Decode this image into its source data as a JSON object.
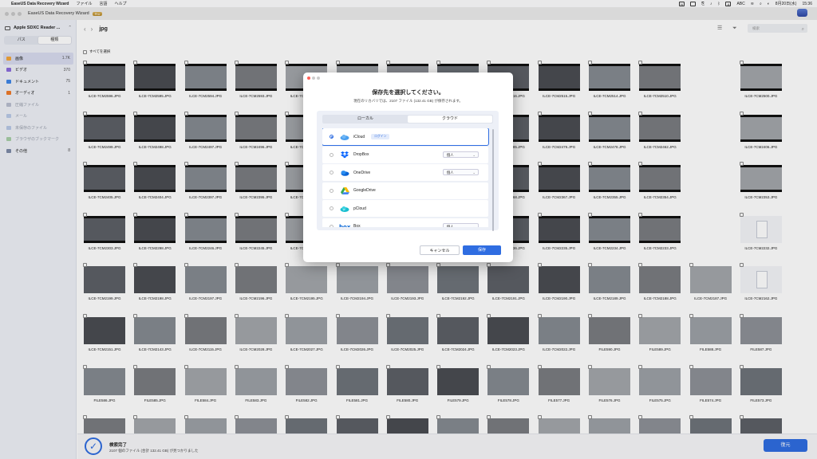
{
  "menubar": {
    "app": "EaseUS Data Recovery Wizard",
    "items": [
      "ファイル",
      "言語",
      "ヘルプ"
    ],
    "date": "8月20日(水)",
    "time": "15:36",
    "input": "ABC"
  },
  "window": {
    "title": "EaseUS Data Recovery Wizard",
    "badge": "Pro"
  },
  "sidebar": {
    "drive": "Apple SDXC Reader ...",
    "segments": [
      "パス",
      "種類"
    ],
    "active_segment": 1,
    "categories": [
      {
        "label": "画像",
        "count": "1.7K",
        "color": "#f2a53a",
        "active": true,
        "dim": false
      },
      {
        "label": "ビデオ",
        "count": "370",
        "color": "#8b6cdd",
        "active": false,
        "dim": false
      },
      {
        "label": "ドキュメント",
        "count": "75",
        "color": "#3f86e8",
        "active": false,
        "dim": false
      },
      {
        "label": "オーディオ",
        "count": "1",
        "color": "#ef7b2b",
        "active": false,
        "dim": false
      },
      {
        "label": "圧縮ファイル",
        "count": "",
        "color": "#b9bed0",
        "active": false,
        "dim": true
      },
      {
        "label": "メール",
        "count": "",
        "color": "#b9c9e8",
        "active": false,
        "dim": true
      },
      {
        "label": "未保存のファイル",
        "count": "",
        "color": "#b8c8e6",
        "active": false,
        "dim": true
      },
      {
        "label": "ブラウザのブックマーク",
        "count": "",
        "color": "#a8cfa8",
        "active": false,
        "dim": true
      },
      {
        "label": "その他",
        "count": "8",
        "color": "#7d8aa8",
        "active": false,
        "dim": false
      }
    ]
  },
  "toolbar": {
    "folder": "jpg",
    "search_placeholder": "検索",
    "select_all": "すべてを選択"
  },
  "files": [
    "ILCE-7CM2596.JPG",
    "ILCE-7CM2595.JPG",
    "ILCE-7CM2594.JPG",
    "ILCE-7CM2593.JPG",
    "ILCE-7CM2592.JPG",
    "ILCE-7CM2591.JPG",
    "ILCE-7CM2590.JPG",
    "ILCE-7CM2589.JPG",
    "ILCE-7CM2516.JPG",
    "ILCE-7CM2515.JPG",
    "ILCE-7CM2514.JPG",
    "ILCE-7CM2510.JPG",
    "ILCE-7CM2500.JPG",
    "ILCE-7CM2499.JPG",
    "ILCE-7CM2498.JPG",
    "ILCE-7CM2497.JPG",
    "ILCE-7CM2496.JPG",
    "ILCE-7CM2495.JPG",
    "ILCE-7CM2494.JPG",
    "ILCE-7CM2493.JPG",
    "ILCE-7CM2491.JPG",
    "ILCE-7CM2485.JPG",
    "ILCE-7CM2479.JPG",
    "ILCE-7CM2478.JPG",
    "ILCE-7CM2462.JPG",
    "ILCE-7CM2406.JPG",
    "ILCE-7CM2405.JPG",
    "ILCE-7CM2404.JPG",
    "ILCE-7CM2397.JPG",
    "ILCE-7CM2395.JPG",
    "ILCE-7CM2394.JPG",
    "ILCE-7CM2392.JPG",
    "ILCE-7CM2391.JPG",
    "ILCE-7CM2389.JPG",
    "ILCE-7CM2368.JPG",
    "ILCE-7CM2367.JPG",
    "ILCE-7CM2355.JPG",
    "ILCE-7CM2354.JPG",
    "ILCE-7CM2353.JPG",
    "ILCE-7CM2303.JPG",
    "ILCE-7CM2298.JPG",
    "ILCE-7CM2246.JPG",
    "ILCE-7CM2245.JPG",
    "ILCE-7CM2244.JPG",
    "ILCE-7CM2242.JPG",
    "ILCE-7CM2241.JPG",
    "ILCE-7CM2240.JPG",
    "ILCE-7CM2236.JPG",
    "ILCE-7CM2235.JPG",
    "ILCE-7CM2234.JPG",
    "ILCE-7CM2233.JPG",
    "ILCE-7CM2232.JPG",
    "ILCE-7CM2199.JPG",
    "ILCE-7CM2198.JPG",
    "ILCE-7CM2197.JPG",
    "ILCE-7CM2196.JPG",
    "ILCE-7CM2195.JPG",
    "ILCE-7CM2194.JPG",
    "ILCE-7CM2193.JPG",
    "ILCE-7CM2192.JPG",
    "ILCE-7CM2191.JPG",
    "ILCE-7CM2190.JPG",
    "ILCE-7CM2189.JPG",
    "ILCE-7CM2188.JPG",
    "ILCE-7CM2187.JPG",
    "ILCE-7CM2162.JPG",
    "ILCE-7CM2151.JPG",
    "ILCE-7CM2143.JPG",
    "ILCE-7CM2115.JPG",
    "ILCE-7CM2028.JPG",
    "ILCE-7CM2027.JPG",
    "ILCE-7CM2026.JPG",
    "ILCE-7CM2025.JPG",
    "ILCE-7CM2024.JPG",
    "ILCE-7CM2023.JPG",
    "ILCE-7CM2022.JPG",
    "FILE590.JPG",
    "FILE589.JPG",
    "FILE588.JPG",
    "FILE587.JPG",
    "FILE586.JPG",
    "FILE585.JPG",
    "FILE584.JPG",
    "FILE583.JPG",
    "FILE582.JPG",
    "FILE581.JPG",
    "FILE580.JPG",
    "FILE579.JPG",
    "FILE578.JPG",
    "FILE577.JPG",
    "FILE576.JPG",
    "FILE575.JPG",
    "FILE574.JPG",
    "FILE573.JPG",
    "",
    "",
    "",
    "",
    "",
    "",
    "",
    "",
    "",
    "",
    "",
    "",
    "",
    ""
  ],
  "status": {
    "title": "検索完了",
    "count": "2107",
    "summary": "2107 個のファイル (合計 132.41 GB) が見つかりました",
    "recover": "復元"
  },
  "dialog": {
    "title": "保存先を選択してください。",
    "subtitle": "現在のリカバリでは、2107 ファイル (132.41 GB) が保存されます。",
    "tabs": [
      "ローカル",
      "クラウド"
    ],
    "active_tab": 1,
    "services": [
      {
        "name": "iCloud",
        "icon": "icloud-icon",
        "selected": true,
        "badge": "ログイン",
        "account": ""
      },
      {
        "name": "DropBox",
        "icon": "dropbox-icon",
        "selected": false,
        "badge": "",
        "account": "個人"
      },
      {
        "name": "OneDrive",
        "icon": "onedrive-icon",
        "selected": false,
        "badge": "",
        "account": "個人"
      },
      {
        "name": "GoogleDrive",
        "icon": "googledrive-icon",
        "selected": false,
        "badge": "",
        "account": ""
      },
      {
        "name": "pCloud",
        "icon": "pcloud-icon",
        "selected": false,
        "badge": "",
        "account": ""
      },
      {
        "name": "Box",
        "icon": "box-icon",
        "selected": false,
        "badge": "",
        "account": "個人"
      }
    ],
    "cancel": "キャンセル",
    "save": "保存"
  }
}
